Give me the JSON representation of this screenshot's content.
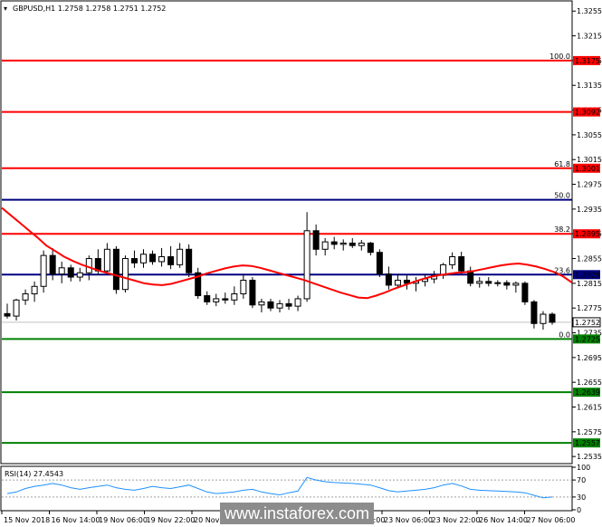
{
  "window": {
    "header": "GBPUSD,H1  1.2758 1.2758 1.2751 1.2752"
  },
  "watermark": "www.instaforex.com",
  "chart_data": {
    "type": "candlestick",
    "symbol": "GBPUSD",
    "timeframe": "H1",
    "ohlc_header": {
      "open": 1.2758,
      "high": 1.2758,
      "low": 1.2751,
      "close": 1.2752
    },
    "ylim": [
      1.2525,
      1.327
    ],
    "y_ticks": [
      1.3255,
      1.3215,
      1.3175,
      1.3135,
      1.3095,
      1.3055,
      1.3015,
      1.2975,
      1.2935,
      1.2895,
      1.2855,
      1.2815,
      1.2775,
      1.2735,
      1.2695,
      1.2655,
      1.2615,
      1.2575,
      1.2535
    ],
    "x_ticks": [
      "15 Nov 2018",
      "16 Nov 14:00",
      "19 Nov 06:00",
      "19 Nov 22:00",
      "20 Nov 14:00",
      "21 Nov 06:00",
      "21 Nov 22:00",
      "22 Nov 14:00",
      "23 Nov 06:00",
      "23 Nov 22:00",
      "26 Nov 14:00",
      "27 Nov 06:00"
    ],
    "current_price": 1.2752,
    "horizontal_lines": [
      {
        "price": 1.3175,
        "color": "#ff0000",
        "label": "1.3175",
        "fib": "100.0"
      },
      {
        "price": 1.3092,
        "color": "#ff0000",
        "label": "1.3092",
        "fib": ""
      },
      {
        "price": 1.3001,
        "color": "#ff0000",
        "label": "1.3001",
        "fib": "61.8"
      },
      {
        "price": 1.295,
        "color": "#000080",
        "label": "",
        "fib": "50.0"
      },
      {
        "price": 1.2895,
        "color": "#ff0000",
        "label": "1.2895",
        "fib": "38.2"
      },
      {
        "price": 1.2829,
        "color": "#000080",
        "label": "1.2829",
        "fib": "23.6"
      },
      {
        "price": 1.2725,
        "color": "#008000",
        "label": "1.2725",
        "fib": "0.0"
      },
      {
        "price": 1.2639,
        "color": "#008000",
        "label": "1.2639",
        "fib": ""
      },
      {
        "price": 1.2557,
        "color": "#008000",
        "label": "1.2557",
        "fib": ""
      }
    ],
    "moving_average": {
      "color": "#ff0000",
      "points": [
        [
          0,
          1.2937
        ],
        [
          1,
          1.2925
        ],
        [
          2,
          1.2913
        ],
        [
          3,
          1.2901
        ],
        [
          4,
          1.2889
        ],
        [
          5,
          1.2876
        ],
        [
          6,
          1.2867
        ],
        [
          7,
          1.2858
        ],
        [
          8,
          1.2851
        ],
        [
          9,
          1.2845
        ],
        [
          10,
          1.284
        ],
        [
          11,
          1.2835
        ],
        [
          12,
          1.2831
        ],
        [
          13,
          1.2827
        ],
        [
          14,
          1.2823
        ],
        [
          15,
          1.2819
        ],
        [
          16,
          1.2815
        ],
        [
          17,
          1.2813
        ],
        [
          18,
          1.2812
        ],
        [
          19,
          1.2814
        ],
        [
          20,
          1.2818
        ],
        [
          21,
          1.2822
        ],
        [
          22,
          1.2826
        ],
        [
          23,
          1.2831
        ],
        [
          24,
          1.2835
        ],
        [
          25,
          1.2839
        ],
        [
          26,
          1.2842
        ],
        [
          27,
          1.2844
        ],
        [
          28,
          1.2843
        ],
        [
          29,
          1.284
        ],
        [
          30,
          1.2836
        ],
        [
          31,
          1.2832
        ],
        [
          32,
          1.2828
        ],
        [
          33,
          1.2824
        ],
        [
          34,
          1.282
        ],
        [
          35,
          1.2815
        ],
        [
          36,
          1.281
        ],
        [
          37,
          1.2805
        ],
        [
          38,
          1.28
        ],
        [
          39,
          1.2796
        ],
        [
          40,
          1.2792
        ],
        [
          41,
          1.2791
        ],
        [
          42,
          1.2795
        ],
        [
          43,
          1.28
        ],
        [
          44,
          1.2806
        ],
        [
          45,
          1.2811
        ],
        [
          46,
          1.2816
        ],
        [
          47,
          1.2821
        ],
        [
          48,
          1.2825
        ],
        [
          49,
          1.2828
        ],
        [
          50,
          1.283
        ],
        [
          51,
          1.2832
        ],
        [
          52,
          1.2833
        ],
        [
          53,
          1.2835
        ],
        [
          54,
          1.2838
        ],
        [
          55,
          1.2841
        ],
        [
          56,
          1.2844
        ],
        [
          57,
          1.2846
        ],
        [
          58,
          1.2847
        ],
        [
          59,
          1.2845
        ],
        [
          60,
          1.2842
        ],
        [
          61,
          1.2838
        ],
        [
          62,
          1.2833
        ],
        [
          63,
          1.2826
        ],
        [
          64,
          1.2816
        ]
      ]
    },
    "candles": [
      [
        1.2766,
        1.2782,
        1.2758,
        1.2762
      ],
      [
        1.2762,
        1.279,
        1.2755,
        1.2788
      ],
      [
        1.2788,
        1.2805,
        1.278,
        1.2798
      ],
      [
        1.2798,
        1.2818,
        1.2785,
        1.281
      ],
      [
        1.281,
        1.2868,
        1.28,
        1.286
      ],
      [
        1.286,
        1.2872,
        1.282,
        1.283
      ],
      [
        1.283,
        1.285,
        1.2815,
        1.284
      ],
      [
        1.284,
        1.2845,
        1.2818,
        1.2825
      ],
      [
        1.2825,
        1.284,
        1.2818,
        1.2832
      ],
      [
        1.2832,
        1.286,
        1.282,
        1.2855
      ],
      [
        1.2855,
        1.287,
        1.2828,
        1.2835
      ],
      [
        1.2835,
        1.288,
        1.283,
        1.287
      ],
      [
        1.287,
        1.2875,
        1.2798,
        1.2805
      ],
      [
        1.2805,
        1.286,
        1.28,
        1.2855
      ],
      [
        1.2855,
        1.2868,
        1.284,
        1.2848
      ],
      [
        1.2848,
        1.287,
        1.284,
        1.2862
      ],
      [
        1.2862,
        1.2868,
        1.2845,
        1.285
      ],
      [
        1.285,
        1.2872,
        1.2842,
        1.2858
      ],
      [
        1.2858,
        1.2875,
        1.2838,
        1.2845
      ],
      [
        1.2845,
        1.288,
        1.284,
        1.287
      ],
      [
        1.287,
        1.2878,
        1.2825,
        1.2832
      ],
      [
        1.2832,
        1.284,
        1.279,
        1.2795
      ],
      [
        1.2795,
        1.2802,
        1.278,
        1.2785
      ],
      [
        1.2785,
        1.2798,
        1.2778,
        1.279
      ],
      [
        1.279,
        1.28,
        1.2782,
        1.2788
      ],
      [
        1.2788,
        1.281,
        1.278,
        1.2798
      ],
      [
        1.2798,
        1.283,
        1.279,
        1.282
      ],
      [
        1.282,
        1.2825,
        1.2775,
        1.278
      ],
      [
        1.278,
        1.279,
        1.2768,
        1.2785
      ],
      [
        1.2785,
        1.279,
        1.277,
        1.2775
      ],
      [
        1.2775,
        1.2788,
        1.2768,
        1.2782
      ],
      [
        1.2782,
        1.279,
        1.2772,
        1.2778
      ],
      [
        1.2778,
        1.2795,
        1.277,
        1.279
      ],
      [
        1.279,
        1.293,
        1.2785,
        1.29
      ],
      [
        1.29,
        1.291,
        1.286,
        1.287
      ],
      [
        1.287,
        1.2888,
        1.286,
        1.2882
      ],
      [
        1.2882,
        1.289,
        1.287,
        1.2878
      ],
      [
        1.2878,
        1.2886,
        1.2868,
        1.288
      ],
      [
        1.288,
        1.2888,
        1.2872,
        1.2876
      ],
      [
        1.2876,
        1.2885,
        1.2868,
        1.288
      ],
      [
        1.288,
        1.2882,
        1.286,
        1.2865
      ],
      [
        1.2865,
        1.287,
        1.2825,
        1.283
      ],
      [
        1.283,
        1.2842,
        1.2805,
        1.2812
      ],
      [
        1.2812,
        1.283,
        1.2808,
        1.282
      ],
      [
        1.282,
        1.2828,
        1.2805,
        1.2815
      ],
      [
        1.2815,
        1.2825,
        1.2802,
        1.2818
      ],
      [
        1.2818,
        1.283,
        1.281,
        1.2822
      ],
      [
        1.2822,
        1.2835,
        1.2815,
        1.2828
      ],
      [
        1.2828,
        1.2848,
        1.2822,
        1.2845
      ],
      [
        1.2845,
        1.2865,
        1.2838,
        1.2858
      ],
      [
        1.2858,
        1.2866,
        1.283,
        1.2835
      ],
      [
        1.2835,
        1.2842,
        1.281,
        1.2815
      ],
      [
        1.2815,
        1.2825,
        1.2808,
        1.2818
      ],
      [
        1.2818,
        1.2825,
        1.281,
        1.2815
      ],
      [
        1.2815,
        1.282,
        1.281,
        1.2816
      ],
      [
        1.2816,
        1.282,
        1.2805,
        1.2812
      ],
      [
        1.2812,
        1.2818,
        1.28,
        1.2815
      ],
      [
        1.2815,
        1.2818,
        1.278,
        1.2785
      ],
      [
        1.2785,
        1.2788,
        1.2742,
        1.275
      ],
      [
        1.275,
        1.277,
        1.274,
        1.2765
      ],
      [
        1.2765,
        1.2768,
        1.2748,
        1.2752
      ]
    ],
    "rsi": {
      "label": "RSI(14) 27.4543",
      "period": 14,
      "value": 27.4543,
      "ylim": [
        0,
        100
      ],
      "ticks": [
        100,
        70,
        30,
        0
      ],
      "levels": [
        70,
        30
      ],
      "values": [
        38,
        42,
        50,
        55,
        58,
        62,
        58,
        52,
        48,
        52,
        55,
        58,
        52,
        48,
        46,
        50,
        55,
        52,
        50,
        54,
        58,
        50,
        42,
        38,
        40,
        42,
        46,
        48,
        42,
        38,
        35,
        40,
        44,
        76,
        70,
        66,
        64,
        63,
        62,
        60,
        58,
        52,
        45,
        42,
        44,
        46,
        48,
        52,
        58,
        62,
        56,
        48,
        46,
        45,
        44,
        43,
        42,
        40,
        34,
        28,
        30
      ]
    }
  }
}
